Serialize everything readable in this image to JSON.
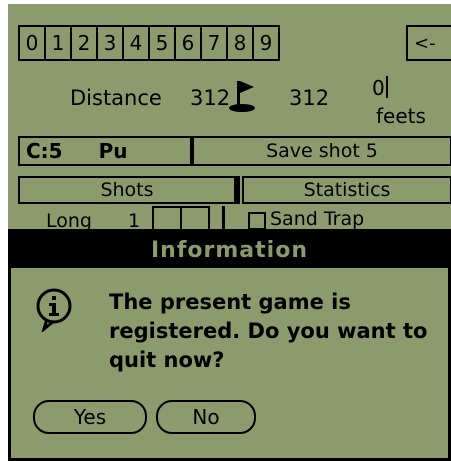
{
  "keypad": {
    "digits": [
      "0",
      "1",
      "2",
      "3",
      "4",
      "5",
      "6",
      "7",
      "8",
      "9"
    ],
    "backspace_label": "<-"
  },
  "distance": {
    "label": "Distance",
    "value_start": "312",
    "value_flag": "312",
    "feet_value": "0",
    "feet_unit": "feets"
  },
  "club": {
    "code": "C:5",
    "name": "Pu"
  },
  "save_label": "Save shot 5",
  "tabs": {
    "shots": "Shots",
    "statistics": "Statistics"
  },
  "shot_row": {
    "label": "Long",
    "value": "1"
  },
  "sand_trap_label": "Sand Trap",
  "dialog": {
    "title": "Information",
    "message": "The present game is registered. Do you want to quit now?",
    "yes_label": "Yes",
    "no_label": "No"
  },
  "colors": {
    "lcd_background": "#8d9a6d",
    "ink": "#000000"
  },
  "icons": {
    "flag": "golf-flag-icon",
    "info": "info-icon"
  }
}
